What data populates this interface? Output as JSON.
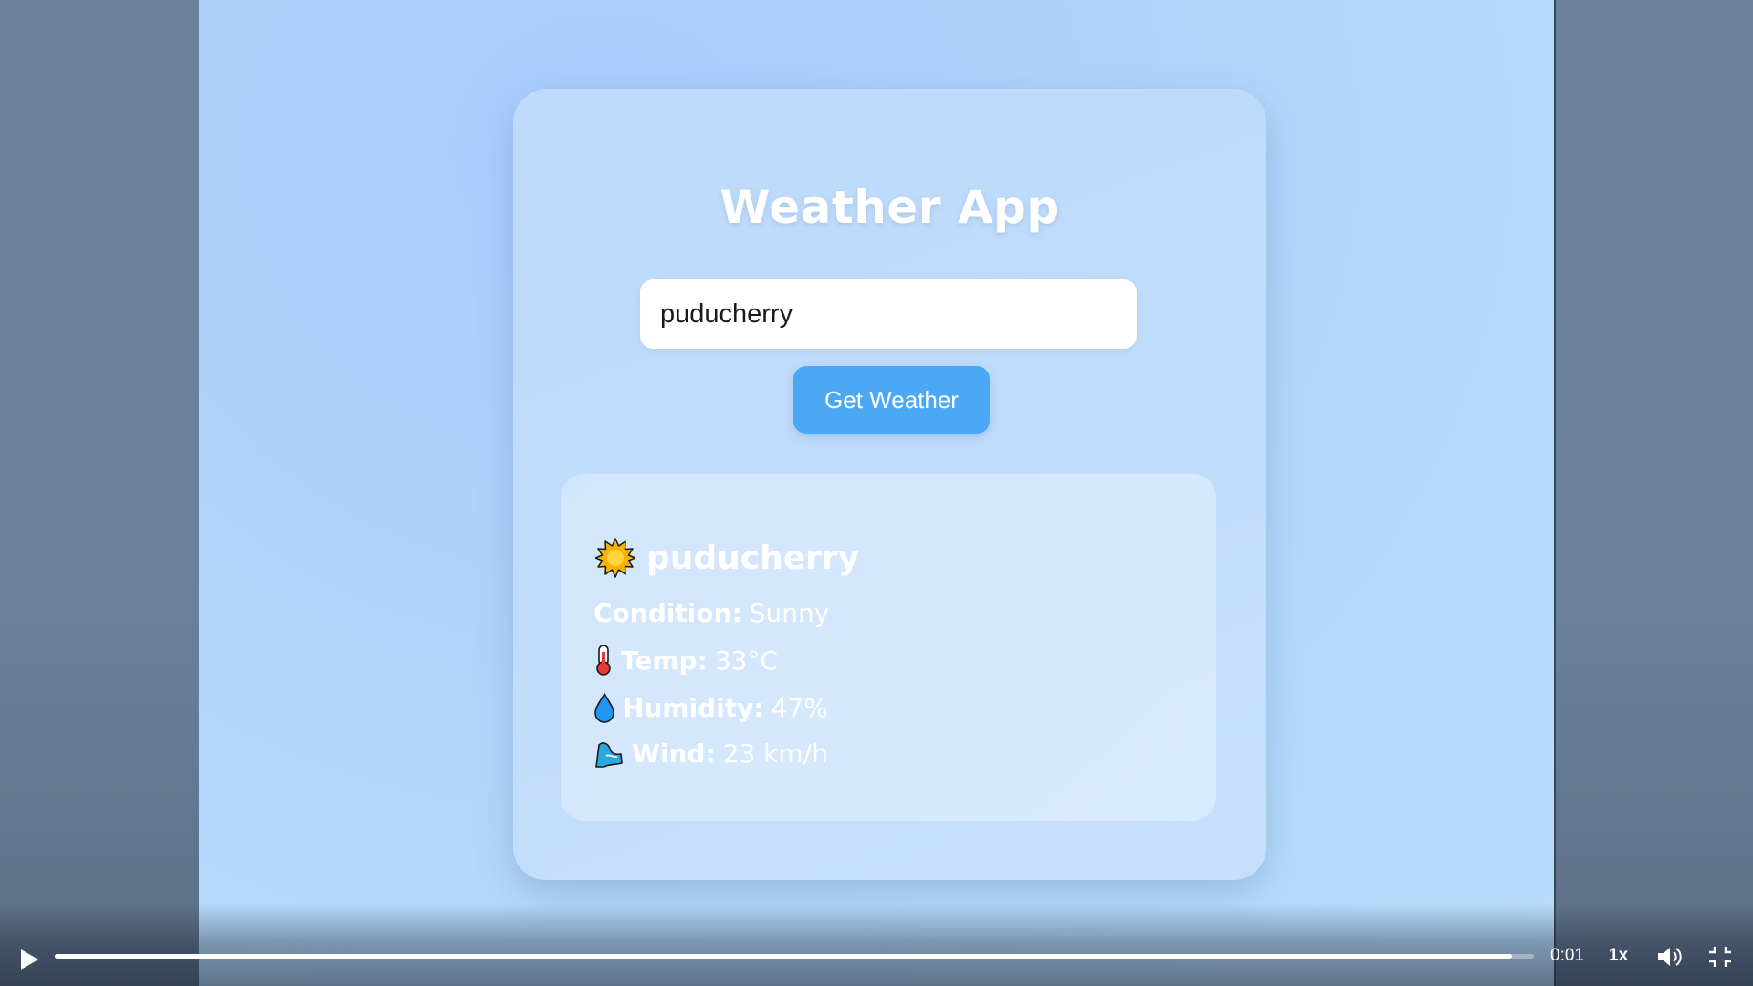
{
  "app": {
    "title": "Weather App",
    "search_value": "puducherry",
    "button_label": "Get Weather"
  },
  "result": {
    "city": "puducherry",
    "weather_icon": "sun-icon",
    "rows": [
      {
        "icon": "none",
        "label": "Condition:",
        "value": "Sunny"
      },
      {
        "icon": "thermometer-icon",
        "label": "Temp:",
        "value": "33°C"
      },
      {
        "icon": "droplet-icon",
        "label": "Humidity:",
        "value": "47%"
      },
      {
        "icon": "wind-icon",
        "label": "Wind:",
        "value": "23 km/h"
      }
    ]
  },
  "player": {
    "time": "0:01",
    "speed": "1x",
    "progress": 0.985
  },
  "colors": {
    "accent": "#4aa8f5",
    "background": "#b5d9fb"
  }
}
